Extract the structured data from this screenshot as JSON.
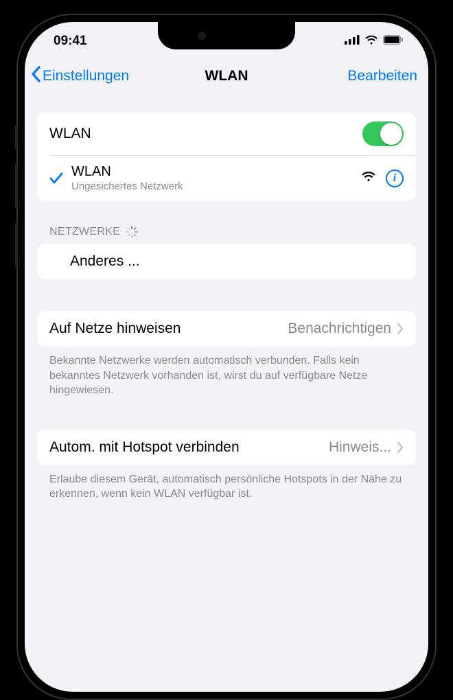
{
  "status": {
    "time": "09:41"
  },
  "nav": {
    "back": "Einstellungen",
    "title": "WLAN",
    "edit": "Bearbeiten"
  },
  "wlan": {
    "toggle_label": "WLAN",
    "connected": {
      "name": "WLAN",
      "security": "Ungesichertes Netzwerk"
    }
  },
  "sections": {
    "networks_header": "NETZWERKE",
    "other_label": "Anderes ..."
  },
  "ask": {
    "label": "Auf Netze hinweisen",
    "value": "Benachrichtigen",
    "footer": "Bekannte Netzwerke werden automatisch verbunden. Falls kein bekanntes Netzwerk vorhanden ist, wirst du auf verfügbare Netze hingewiesen."
  },
  "hotspot": {
    "label": "Autom. mit Hotspot verbinden",
    "value": "Hinweis...",
    "footer": "Erlaube diesem Gerät, automatisch persönliche Hotspots in der Nähe zu erkennen, wenn kein WLAN verfügbar ist."
  }
}
